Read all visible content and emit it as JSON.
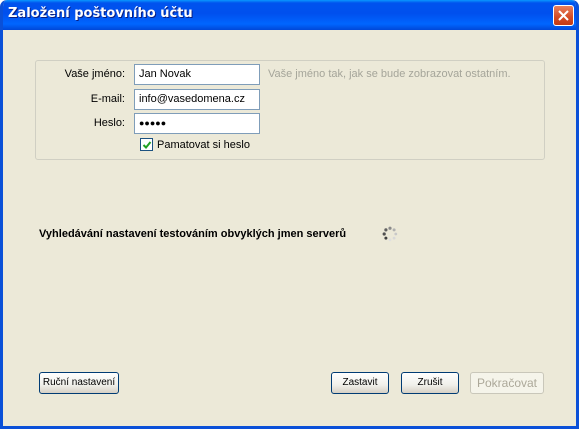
{
  "window": {
    "title": "Založení poštovního účtu"
  },
  "form": {
    "name_label": "Vaše jméno:",
    "name_value": "Jan Novak",
    "name_hint": "Vaše jméno tak, jak se bude zobrazovat ostatním.",
    "email_label": "E-mail:",
    "email_value": "info@vasedomena.cz",
    "password_label": "Heslo:",
    "password_value": "●●●●●",
    "remember_label": "Pamatovat si heslo",
    "remember_checked": true
  },
  "status": {
    "text": "Vyhledávání nastavení testováním obvyklých jmen serverů"
  },
  "buttons": {
    "manual": "Ruční nastavení",
    "stop": "Zastavit",
    "cancel": "Zrušit",
    "continue": "Pokračovat"
  },
  "icons": {
    "close": "close-icon",
    "check": "checkmark-icon",
    "spinner": "loading-spinner-icon"
  }
}
